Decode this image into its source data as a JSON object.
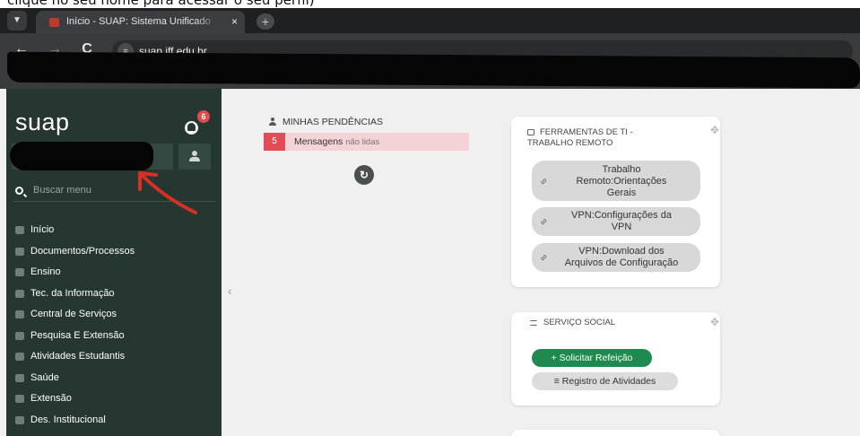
{
  "caption": "clique no seu nome para acessar o seu perfil)",
  "browser": {
    "tab_title": "Início - SUAP: Sistema Unificado",
    "tab_close": "×",
    "new_tab": "+",
    "url": "suap.iff.edu.br"
  },
  "sidebar": {
    "logo": "suap",
    "notification_count": "6",
    "search_placeholder": "Buscar menu",
    "items": [
      {
        "label": "Início",
        "icon": "home-icon"
      },
      {
        "label": "Documentos/Processos",
        "icon": "folder-icon"
      },
      {
        "label": "Ensino",
        "icon": "book-icon"
      },
      {
        "label": "Tec. da Informação",
        "icon": "monitor-icon"
      },
      {
        "label": "Central de Serviços",
        "icon": "service-icon"
      },
      {
        "label": "Pesquisa E Extensão",
        "icon": "flask-icon"
      },
      {
        "label": "Atividades Estudantis",
        "icon": "student-icon"
      },
      {
        "label": "Saúde",
        "icon": "heart-icon"
      },
      {
        "label": "Extensão",
        "icon": "extension-icon"
      },
      {
        "label": "Des. Institucional",
        "icon": "chart-icon"
      }
    ]
  },
  "pendencias": {
    "title": "MINHAS PENDÊNCIAS",
    "count": "5",
    "label_main": "Mensagens",
    "label_muted": "não lidas"
  },
  "card_ti": {
    "title_line1": "FERRAMENTAS DE TI -",
    "title_line2": "TRABALHO REMOTO",
    "links": [
      {
        "line1": "Trabalho",
        "line2": "Remoto:Orientações",
        "line3": "Gerais"
      },
      {
        "line1": "VPN:Configurações da",
        "line2": "VPN"
      },
      {
        "line1": "VPN:Download dos",
        "line2": "Arquivos de Configuração"
      }
    ]
  },
  "card_social": {
    "title": "SERVIÇO SOCIAL",
    "primary_button": "Solicitar Refeição",
    "secondary_button": "Registro de Atividades"
  },
  "colors": {
    "sidebar_bg": "#253730",
    "accent_green": "#1e8a4f",
    "badge_red": "#e04d56"
  }
}
